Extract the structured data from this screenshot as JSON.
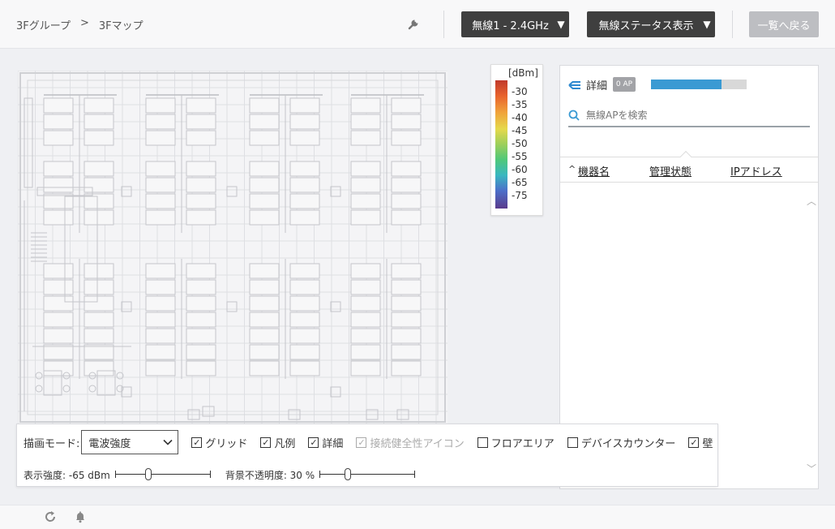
{
  "header": {
    "breadcrumb": [
      "3Fグループ",
      ">",
      "3Fマップ"
    ],
    "wireless_select": "無線1 - 2.4GHz",
    "status_select": "無線ステータス表示",
    "back_button": "一覧へ戻る"
  },
  "legend": {
    "unit": "[dBm]",
    "ticks": [
      "-30",
      "-35",
      "-40",
      "-45",
      "-50",
      "-55",
      "-60",
      "-65",
      "-75"
    ]
  },
  "detail": {
    "title": "詳細",
    "ap_badge": "0 AP",
    "search_placeholder": "無線APを検索",
    "columns": [
      "機器名",
      "管理状態",
      "IPアドレス"
    ],
    "progress_fraction": 0.74
  },
  "controls": {
    "mode_label": "描画モード:",
    "mode_value": "電波強度",
    "checkboxes": [
      {
        "label": "グリッド",
        "checked": true
      },
      {
        "label": "凡例",
        "checked": true
      },
      {
        "label": "詳細",
        "checked": true
      },
      {
        "label": "接続健全性アイコン",
        "checked": true,
        "disabled": true
      },
      {
        "label": "フロアエリア",
        "checked": false
      },
      {
        "label": "デバイスカウンター",
        "checked": false
      },
      {
        "label": "壁",
        "checked": true
      }
    ],
    "strength_label": "表示強度: -65 dBm",
    "opacity_label": "背景不透明度: 30 %"
  },
  "icons": {
    "wrench": "wrench-icon",
    "refresh": "refresh-icon",
    "bell": "bell-icon",
    "back_arrow": "collapse-arrow-icon",
    "search": "search-icon"
  },
  "colors": {
    "accent": "#3a9ad3",
    "dark_button": "#3f3f3f"
  }
}
